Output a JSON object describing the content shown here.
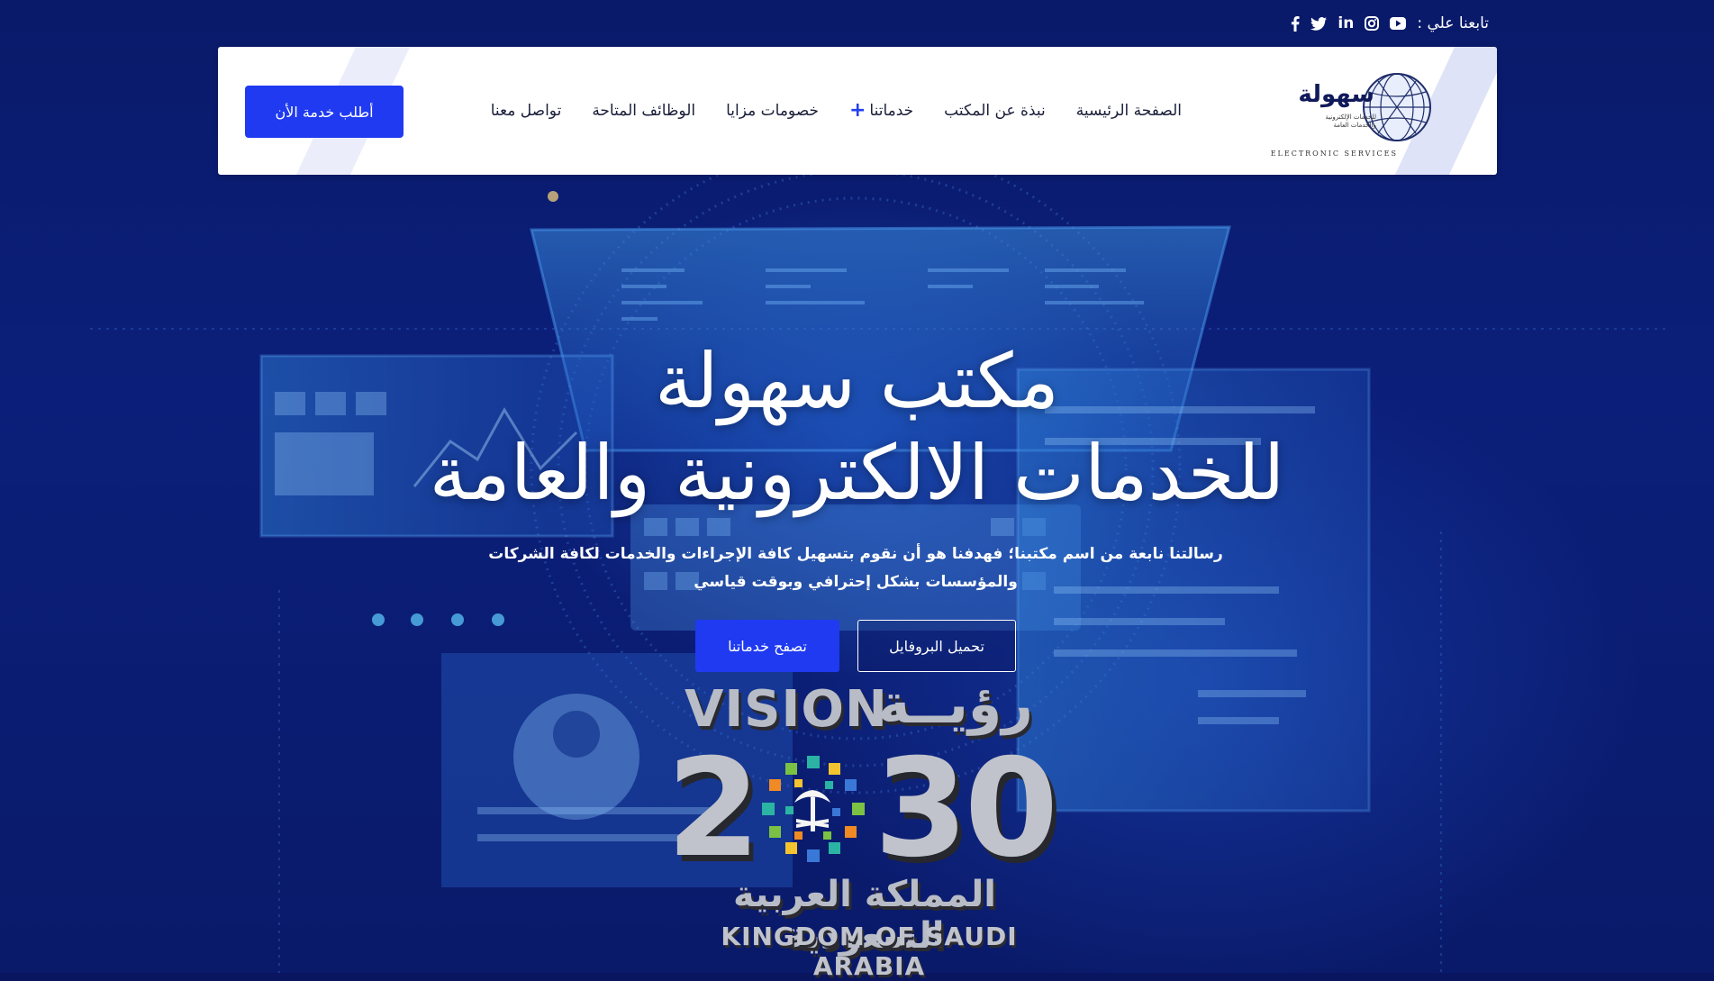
{
  "social": {
    "follow_label": "تابعنا علي :",
    "icons": [
      "youtube-icon",
      "instagram-icon",
      "linkedin-icon",
      "twitter-icon",
      "facebook-icon"
    ],
    "icon_glyphs": {
      "linkedin": "in"
    }
  },
  "header": {
    "logo": {
      "wordmark": "سهولة",
      "tagline": "للخدمات الإلكترونية والخدمات العامة",
      "subtitle": "ELECTRONIC SERVICES"
    },
    "nav": [
      {
        "label": "الصفحة الرئيسية"
      },
      {
        "label": "نبذة عن المكتب"
      },
      {
        "label": "خدماتنا",
        "has_dropdown": true,
        "dropdown_glyph": "+"
      },
      {
        "label": "خصومات مزايا"
      },
      {
        "label": "الوظائف المتاحة"
      },
      {
        "label": "تواصل معنا"
      }
    ],
    "cta_label": "أطلب خدمة الأن"
  },
  "hero": {
    "title_line1": "مكتب سهولة",
    "title_line2": "للخدمات الالكترونية والعامة",
    "description_line1": "رسالتنا نابعة من اسم مكتبنا؛ فهدفنا هو أن نقوم بتسهيل كافة الإجراءات والخدمات لكافة الشركات",
    "description_line2": "والمؤسسات بشكل إحترافي وبوقت قياسي",
    "primary_button": "تصفح خدماتنا",
    "secondary_button": "تحميل البروفايل"
  },
  "vision": {
    "word_en": "VISION",
    "word_ar": "رؤيــة",
    "year_left": "2",
    "year_right": "30",
    "country_ar": "المملكة العربية السعودية",
    "country_en": "KINGDOM OF SAUDI ARABIA"
  },
  "colors": {
    "background": "#0a1560",
    "accent_blue": "#1f3af0",
    "nav_text": "#1a1f3a",
    "header_bg": "#ffffff"
  }
}
